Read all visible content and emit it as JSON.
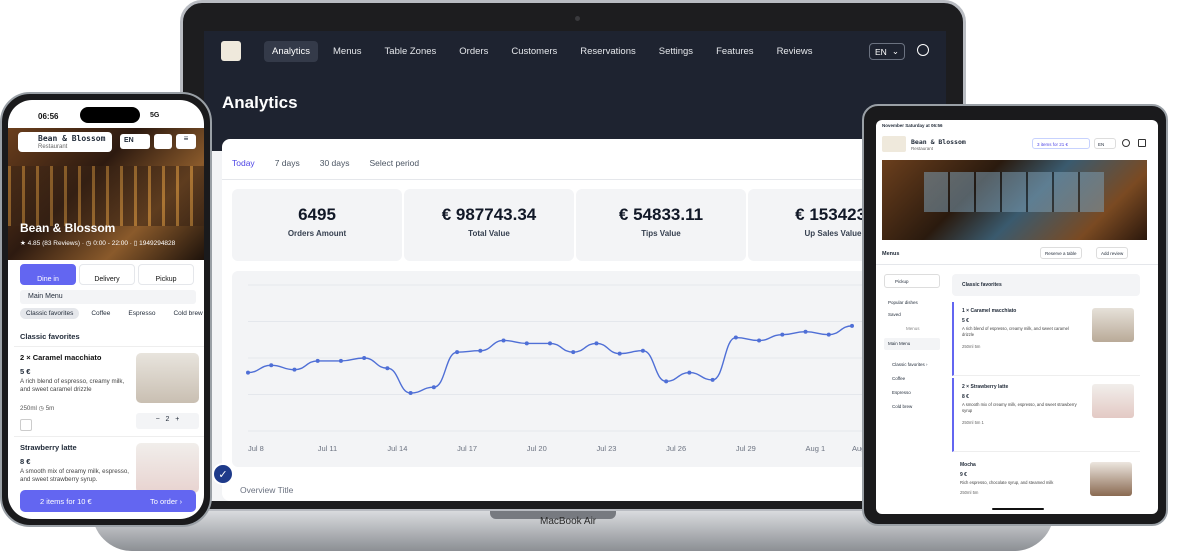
{
  "laptop": {
    "nav": [
      "Analytics",
      "Menus",
      "Table Zones",
      "Orders",
      "Customers",
      "Reservations",
      "Settings",
      "Features",
      "Reviews"
    ],
    "lang": "EN",
    "page_title": "Analytics",
    "tabs": [
      "Today",
      "7 days",
      "30 days",
      "Select period"
    ],
    "stats": [
      {
        "value": "6495",
        "label": "Orders Amount"
      },
      {
        "value": "€ 987743.34",
        "label": "Total Value"
      },
      {
        "value": "€ 54833.11",
        "label": "Tips Value"
      },
      {
        "value": "€ 153423.",
        "label": "Up Sales Value"
      }
    ],
    "overview_title": "Overview Title",
    "device_label": "MacBook Air",
    "accent": "#4f46e5"
  },
  "chart_data": {
    "type": "line",
    "x": [
      "Jul 8",
      "Jul 9",
      "Jul 10",
      "Jul 11",
      "Jul 12",
      "Jul 13",
      "Jul 14",
      "Jul 15",
      "Jul 16",
      "Jul 17",
      "Jul 18",
      "Jul 19",
      "Jul 20",
      "Jul 21",
      "Jul 22",
      "Jul 23",
      "Jul 24",
      "Jul 25",
      "Jul 26",
      "Jul 27",
      "Jul 28",
      "Jul 29",
      "Jul 30",
      "Jul 31",
      "Aug 1",
      "Aug 2",
      "Aug 3"
    ],
    "xticks": [
      "Jul 8",
      "Jul 11",
      "Jul 14",
      "Jul 17",
      "Jul 20",
      "Jul 23",
      "Jul 26",
      "Jul 29",
      "Aug 1",
      "Aug"
    ],
    "values": [
      40,
      45,
      42,
      48,
      48,
      50,
      43,
      26,
      30,
      54,
      55,
      62,
      60,
      60,
      54,
      60,
      53,
      55,
      34,
      40,
      35,
      64,
      62,
      66,
      68,
      66,
      72
    ],
    "ylim": [
      0,
      100
    ],
    "line_color": "#4f6fd6",
    "grid": true
  },
  "phone": {
    "time": "06:56",
    "signal": "5G",
    "brand": "Bean & Blossom",
    "brand_sub": "Restaurant",
    "lang": "EN",
    "name": "Bean & Blossom",
    "rating": "★ 4.85 (83 Reviews) · ◷ 0:00 - 22:00 · ▯ 1949294828",
    "modes": [
      "Dine in",
      "Delivery",
      "Pickup"
    ],
    "menu_select": "Main Menu",
    "categories": [
      "Classic favorites",
      "Coffee",
      "Espresso",
      "Cold brew"
    ],
    "section": "Classic favorites",
    "items": [
      {
        "title": "2 × Caramel macchiato",
        "price": "5 €",
        "desc": "A rich blend of espresso, creamy milk, and sweet caramel drizzle",
        "meta": "250ml   ◷ 5m",
        "qty": "2"
      },
      {
        "title": "Strawberry latte",
        "price": "8 €",
        "desc": "A smooth mix of creamy milk, espresso, and sweet strawberry syrup."
      }
    ],
    "order_left": "2 items for 10 €",
    "order_right": "To order ›"
  },
  "tablet": {
    "status": "November Saturday at 06:56",
    "brand": "Bean & Blossom",
    "brand_sub": "Restaurant",
    "cart": "3 items for 21 €",
    "lang": "EN",
    "menus": "Menus",
    "reserve": "Reserve a table",
    "review": "Add review",
    "pickup": "Pickup",
    "popular": "Popular dishes",
    "saved": "Saved",
    "menus_divider": "Menus",
    "main_menu": "Main Menu",
    "left_cats": [
      "Classic favorites ›",
      "Coffee",
      "Espresso",
      "Cold brew"
    ],
    "classic": "Classic favorites",
    "items": [
      {
        "title": "1 × Caramel macchiato",
        "price": "5 €",
        "desc": "A rich blend of espresso, creamy milk, and sweet caramel drizzle",
        "meta": "250ml   5m"
      },
      {
        "title": "2 × Strawberry latte",
        "price": "8 €",
        "desc": "A smooth mix of creamy milk, espresso, and sweet strawberry syrup",
        "meta": "250ml   5m   1"
      },
      {
        "title": "Mocha",
        "price": "9 €",
        "desc": "Rich espresso, chocolate syrup, and steamed milk",
        "meta": "250ml   5m"
      }
    ]
  }
}
